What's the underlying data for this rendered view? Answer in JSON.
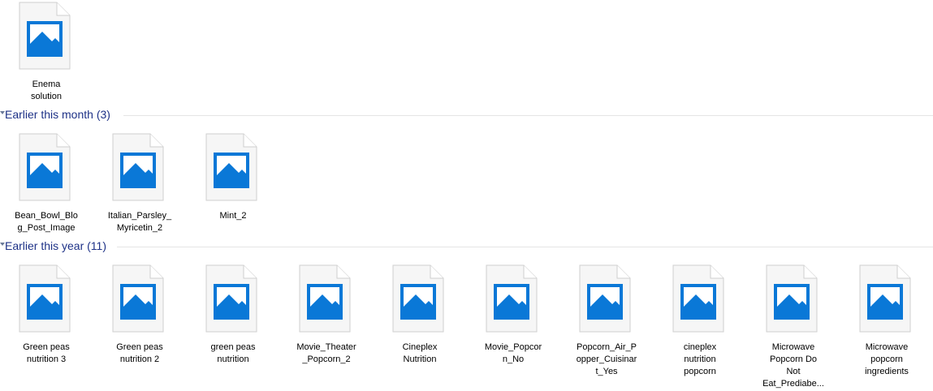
{
  "top_items": [
    {
      "label": "Enema\nsolution"
    }
  ],
  "groups": [
    {
      "title": "Earlier this month (3)",
      "items": [
        {
          "label": "Bean_Bowl_Blo\ng_Post_Image"
        },
        {
          "label": "Italian_Parsley_\nMyricetin_2"
        },
        {
          "label": "Mint_2"
        }
      ]
    },
    {
      "title": "Earlier this year (11)",
      "items": [
        {
          "label": "Green peas\nnutrition 3"
        },
        {
          "label": "Green peas\nnutrition 2"
        },
        {
          "label": "green peas\nnutrition"
        },
        {
          "label": "Movie_Theater\n_Popcorn_2"
        },
        {
          "label": "Cineplex\nNutrition"
        },
        {
          "label": "Movie_Popcor\nn_No"
        },
        {
          "label": "Popcorn_Air_P\nopper_Cuisinar\nt_Yes"
        },
        {
          "label": "cineplex\nnutrition\npopcorn"
        },
        {
          "label": "Microwave\nPopcorn Do\nNot\nEat_Prediabe..."
        },
        {
          "label": "Microwave\npopcorn\ningredients"
        }
      ]
    }
  ],
  "colors": {
    "group_title": "#1e3287",
    "icon_blue": "#0a78d7",
    "file_page": "#f6f6f6"
  },
  "icons": {
    "file": "image-file-icon"
  }
}
